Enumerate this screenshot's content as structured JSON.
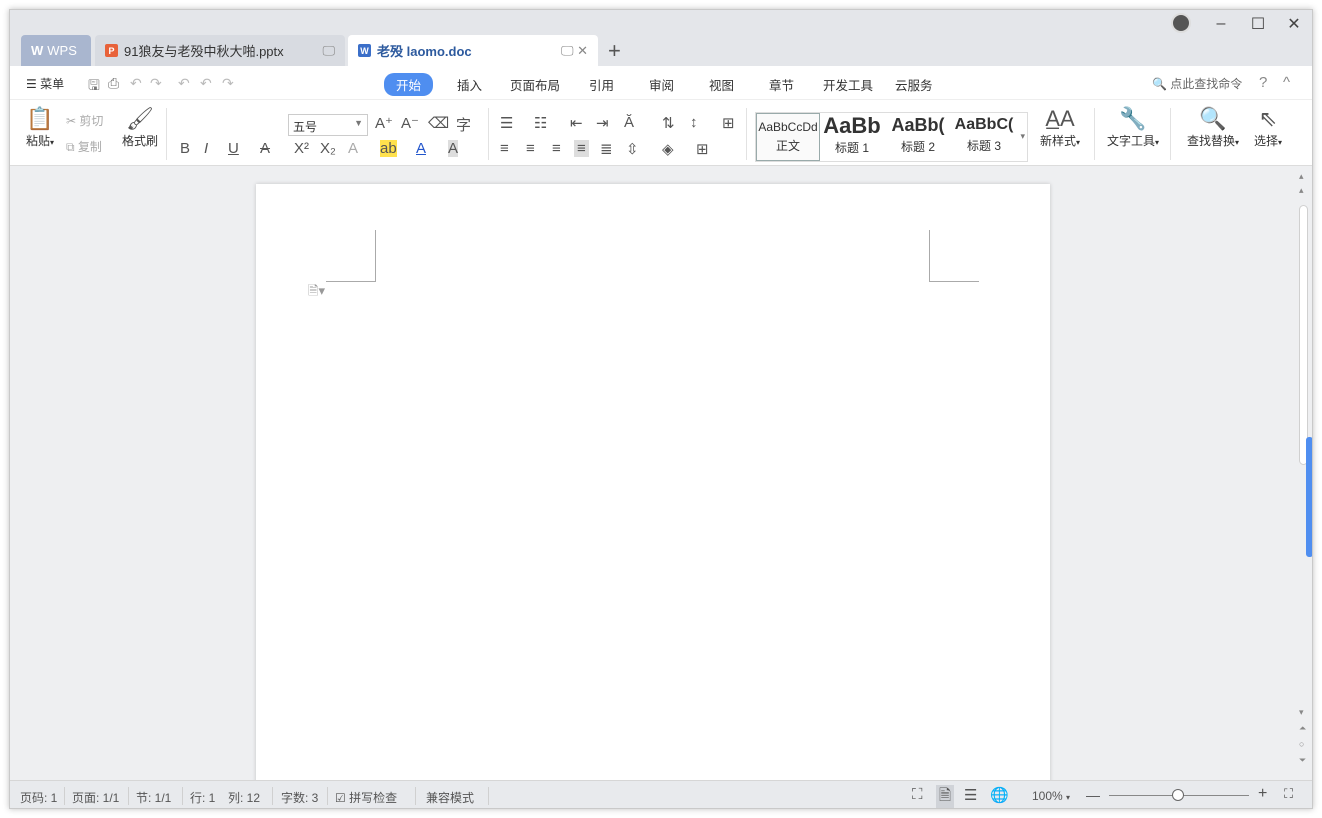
{
  "tabs": {
    "wps": "WPS",
    "pptx": "91狼友与老殁中秋大啪.pptx",
    "doc": "老殁 laomo.doc",
    "new_tab": "+"
  },
  "window_controls": {
    "minimize": "–",
    "maximize": "☐",
    "close": "✕"
  },
  "menu": {
    "menu_label": "菜单",
    "ribbon_tabs": [
      "开始",
      "插入",
      "页面布局",
      "引用",
      "审阅",
      "视图",
      "章节",
      "开发工具",
      "云服务"
    ],
    "search_command": "点此查找命令",
    "help": "?",
    "collapse": "^"
  },
  "ribbon": {
    "paste": "粘贴",
    "cut": "剪切",
    "copy": "复制",
    "format_painter": "格式刷",
    "font_size": "五号",
    "styles": [
      {
        "preview": "AaBbCcDd",
        "name": "正文"
      },
      {
        "preview": "AaBb",
        "name": "标题 1"
      },
      {
        "preview": "AaBb(",
        "name": "标题 2"
      },
      {
        "preview": "AaBbC(",
        "name": "标题 3"
      }
    ],
    "new_style": "新样式",
    "text_tools": "文字工具",
    "find_replace": "查找替换",
    "select": "选择"
  },
  "status": {
    "page_num": "页码: 1",
    "page": "页面: 1/1",
    "section": "节: 1/1",
    "row": "行: 1",
    "col": "列: 12",
    "word_count": "字数: 3",
    "spell_check": "拼写检查",
    "compat_mode": "兼容模式",
    "zoom": "100%",
    "zoom_out": "—",
    "zoom_in": "+"
  },
  "colors": {
    "accent": "#4f8ef0",
    "doc_tab": "#2d5a9e"
  }
}
